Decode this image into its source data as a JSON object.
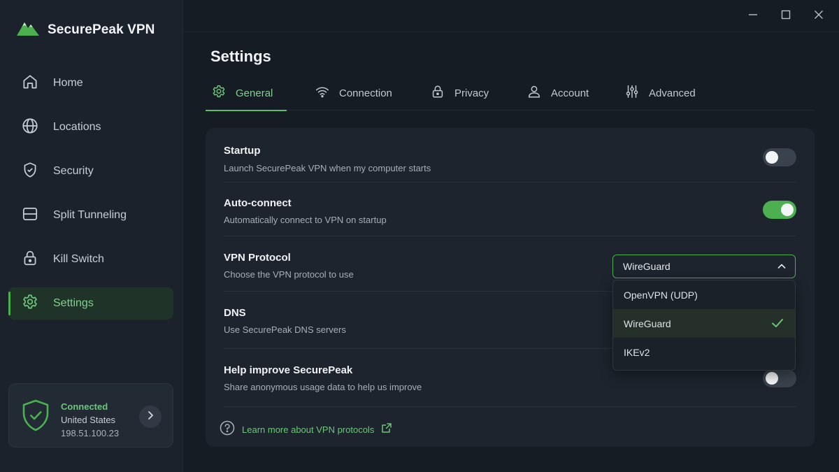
{
  "app": {
    "name": "SecurePeak VPN"
  },
  "sidebar": {
    "items": [
      {
        "label": "Home",
        "icon": "home-icon"
      },
      {
        "label": "Locations",
        "icon": "globe-icon"
      },
      {
        "label": "Security",
        "icon": "shield-icon"
      },
      {
        "label": "Split Tunneling",
        "icon": "split-icon"
      },
      {
        "label": "Kill Switch",
        "icon": "lock-icon"
      },
      {
        "label": "Settings",
        "icon": "gear-icon",
        "active": true
      }
    ],
    "status": {
      "state": "Connected",
      "location": "United States",
      "ip": "198.51.100.23"
    }
  },
  "page": {
    "title": "Settings"
  },
  "tabs": [
    {
      "label": "General",
      "icon": "gear-icon",
      "active": true
    },
    {
      "label": "Connection",
      "icon": "wifi-icon"
    },
    {
      "label": "Privacy",
      "icon": "lock-icon"
    },
    {
      "label": "Account",
      "icon": "user-icon"
    },
    {
      "label": "Advanced",
      "icon": "sliders-icon"
    }
  ],
  "settings": {
    "startup": {
      "title": "Startup",
      "subtitle": "Launch SecurePeak VPN when my computer starts",
      "enabled": false
    },
    "autoconnect": {
      "title": "Auto-connect",
      "subtitle": "Automatically connect to VPN on startup",
      "enabled": true
    },
    "protocol": {
      "title": "VPN Protocol",
      "subtitle": "Choose the VPN protocol to use",
      "selected": "WireGuard",
      "options": [
        "OpenVPN (UDP)",
        "WireGuard",
        "IKEv2"
      ]
    },
    "dns": {
      "title": "DNS",
      "subtitle": "Use SecurePeak DNS servers"
    },
    "telemetry": {
      "title": "Help improve SecurePeak",
      "subtitle": "Share anonymous usage data to help us improve",
      "enabled": false
    }
  },
  "footer": {
    "link": "Learn more about VPN protocols"
  },
  "colors": {
    "accent": "#4caf50",
    "accent_text": "#7fd38c",
    "background": "#161c24",
    "panel": "#1d242d"
  }
}
